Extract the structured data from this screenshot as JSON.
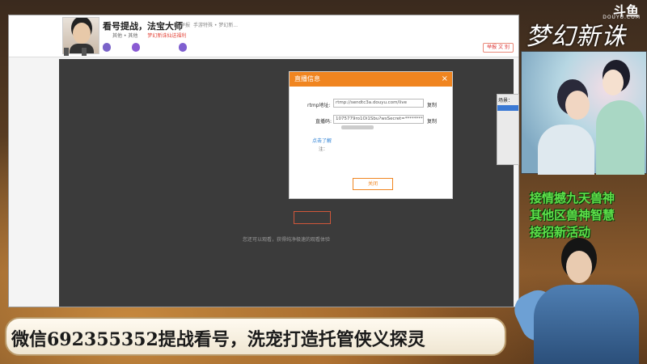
{
  "header": {
    "tab_small_1": "",
    "tab_small_2": "",
    "room_title": "看号提战，法宝大师",
    "title_tag": "举报",
    "title_meta": "手游特殊 • 梦幻新...",
    "level_badge": "",
    "category": "其他 • 其他",
    "hot_count": "",
    "meta_line": "梦幻新诛仙送福利",
    "meta_follow": "",
    "meta_weight": "",
    "pill_1": "",
    "pill_2": "",
    "pill_3": "",
    "report_label": "举报 文 别"
  },
  "stage": {
    "button_label": "",
    "tip_prefix": "您还可以",
    "tip_link": "",
    "tip_suffix": "观看，获得纯净极速的观看体验"
  },
  "dialog": {
    "title": "直播信息",
    "close_glyph": "×",
    "rtmp_label": "rtmp地址:",
    "rtmp_value": "rtmp://sendtc3a.douyu.com/live",
    "copy_1": "复制",
    "code_label": "直播码:",
    "code_value": "1075779ro1Oi1Sbu?wsSecret=********",
    "copy_2": "复制",
    "warning": "",
    "warning_link": "点击了解",
    "notes_title": "注：",
    "note_1": "",
    "note_2": "",
    "ok_label": "关闭"
  },
  "right_panel": {
    "label": "场景：",
    "selected": ""
  },
  "brand": {
    "game_logo": "梦幻新诛仙",
    "platform": "斗鱼",
    "platform_sub": "DOUYU.COM"
  },
  "promo": {
    "line_1": "接情撼九天兽神",
    "line_2": "其他区兽神智慧",
    "line_3": "接招新活动"
  },
  "banner": {
    "text": "微信692355352提战看号，洗宠打造托管侠义探灵"
  },
  "colors": {
    "accent": "#f08520",
    "promo_green": "#5de04a",
    "warning_red": "#e4453a"
  }
}
